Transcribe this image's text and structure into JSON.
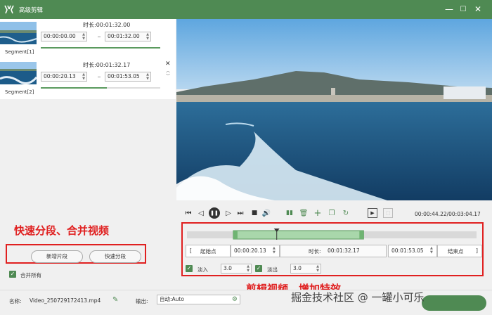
{
  "window": {
    "title": "高级剪辑",
    "min": "—",
    "max": "☐",
    "close": "✕"
  },
  "segments": [
    {
      "name": "Segment[1]",
      "duration_label": "时长:",
      "duration": "00:01:32.00",
      "start": "00:00:00.00",
      "end": "00:01:32.00",
      "progress": 1.0
    },
    {
      "name": "Segment[2]",
      "duration_label": "时长:",
      "duration": "00:01:32.17",
      "start": "00:00:20.13",
      "end": "00:01:53.05",
      "progress": 0.55
    }
  ],
  "left": {
    "annotation": "快速分段、合并视频",
    "new_segment": "新增片段",
    "quick_split": "快速分段",
    "merge_all": "合并所有"
  },
  "player": {
    "time": "00:00:44.22/00:03:04.17"
  },
  "edit": {
    "annotation": "剪辑视频、增加特效",
    "start_point": "起始点",
    "start_time": "00:00:20.13",
    "duration_label": "时长:",
    "duration": "00:01:32.17",
    "end_time": "00:01:53.05",
    "end_point": "结束点",
    "fade_in_label": "淡入",
    "fade_in": "3.0",
    "fade_out_label": "淡出",
    "fade_out": "3.0",
    "selection": {
      "start": 0.16,
      "end": 0.61
    },
    "playhead": 0.31
  },
  "bottom": {
    "name_label": "名称:",
    "name_value": "Video_250729172413.mp4",
    "output_label": "输出:",
    "output_value": "自动:Auto"
  },
  "watermark": "掘金技术社区 @ 一罐小可乐"
}
